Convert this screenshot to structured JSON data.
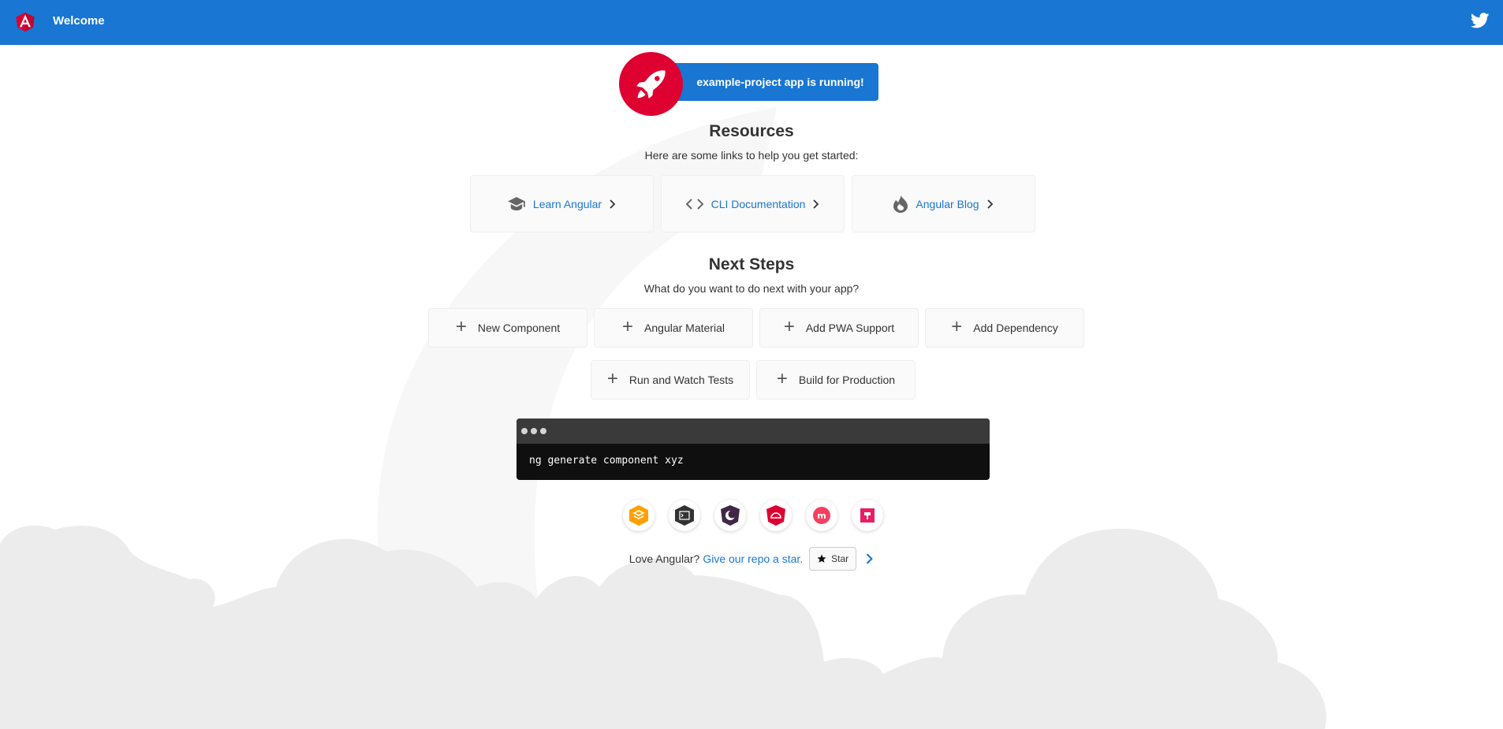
{
  "toolbar": {
    "title": "Welcome",
    "logo_icon": "angular-logo-icon",
    "social_icon": "twitter-icon"
  },
  "banner": {
    "text": "example-project app is running!",
    "icon": "rocket-icon"
  },
  "resources": {
    "heading": "Resources",
    "subtitle": "Here are some links to help you get started:",
    "links": [
      {
        "label": "Learn Angular",
        "icon": "graduation-cap-icon"
      },
      {
        "label": "CLI Documentation",
        "icon": "code-icon"
      },
      {
        "label": "Angular Blog",
        "icon": "flame-icon"
      }
    ]
  },
  "next_steps": {
    "heading": "Next Steps",
    "subtitle": "What do you want to do next with your app?",
    "actions": [
      {
        "label": "New Component"
      },
      {
        "label": "Angular Material"
      },
      {
        "label": "Add PWA Support"
      },
      {
        "label": "Add Dependency"
      },
      {
        "label": "Run and Watch Tests"
      },
      {
        "label": "Build for Production"
      }
    ]
  },
  "terminal": {
    "command": "ng generate component xyz"
  },
  "partner_icons": [
    "firebase-icon",
    "terminal-icon",
    "crescent-icon",
    "shield-icon",
    "meetup-icon",
    "discord-icon"
  ],
  "footer": {
    "prompt": "Love Angular?",
    "link": "Give our repo a star.",
    "star_label": "Star"
  },
  "colors": {
    "toolbar": "#1976d2",
    "accent": "#dd0031",
    "link": "#1976d2"
  }
}
